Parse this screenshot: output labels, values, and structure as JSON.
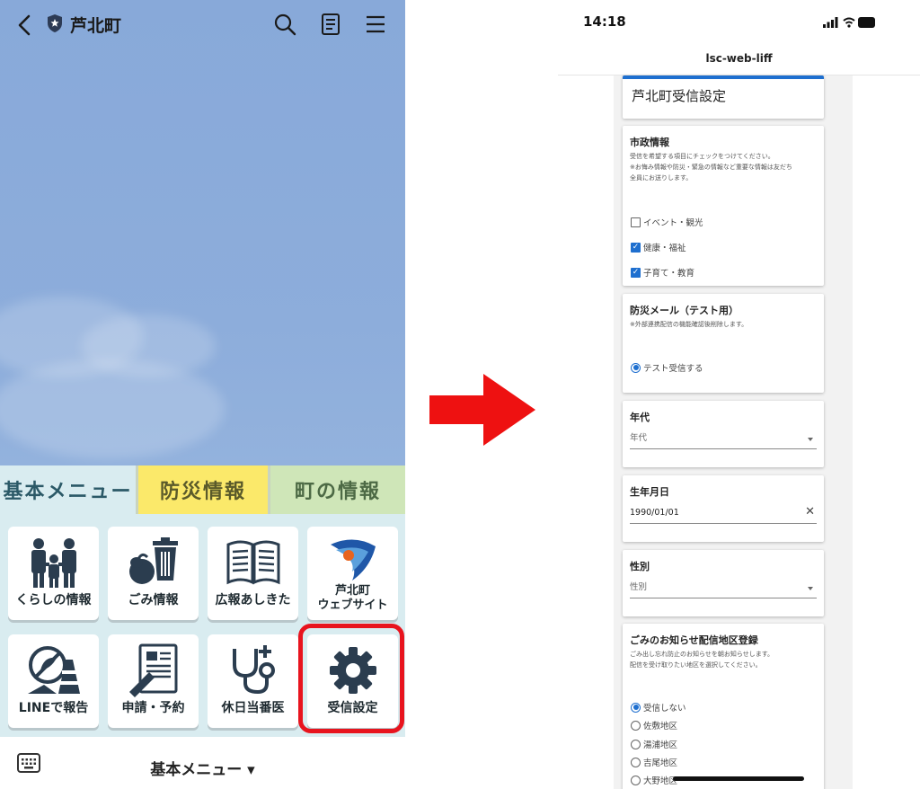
{
  "left": {
    "header": {
      "title": "芦北町"
    },
    "tabs": [
      "基本メニュー",
      "防災情報",
      "町の情報"
    ],
    "menu": [
      {
        "label": "くらしの情報",
        "icon": "family-icon"
      },
      {
        "label": "ごみ情報",
        "icon": "trash-icon"
      },
      {
        "label": "広報あしきた",
        "icon": "book-icon"
      },
      {
        "label": "芦北町\nウェブサイト",
        "icon": "town-logo-icon"
      },
      {
        "label": "LINEで報告",
        "icon": "report-icon"
      },
      {
        "label": "申請・予約",
        "icon": "document-icon"
      },
      {
        "label": "休日当番医",
        "icon": "stethoscope-icon"
      },
      {
        "label": "受信設定",
        "icon": "gear-icon"
      }
    ],
    "bottom": {
      "label": "基本メニュー ▾"
    },
    "highlight_color": "#e8141e"
  },
  "arrow_color": "#ee1111",
  "right": {
    "status": {
      "time": "14:18",
      "battery": "58"
    },
    "url": "lsc-web-liff",
    "title": "芦北町受信設定",
    "sections": {
      "city": {
        "title": "市政情報",
        "desc1": "受信を希望する項目にチェックをつけてください。",
        "desc2": "※お悔み情報や防災・緊急の情報など重要な情報は友だち",
        "desc3": "全員にお送りします。",
        "options": [
          {
            "label": "イベント・観光",
            "checked": false
          },
          {
            "label": "健康・福祉",
            "checked": true
          },
          {
            "label": "子育て・教育",
            "checked": true
          }
        ]
      },
      "disaster": {
        "title": "防災メール（テスト用）",
        "desc": "※外部連携配信の機能確認後削除します。",
        "option": "テスト受信する"
      },
      "age": {
        "title": "年代",
        "placeholder": "年代"
      },
      "birth": {
        "title": "生年月日",
        "value": "1990/01/01"
      },
      "gender": {
        "title": "性別",
        "placeholder": "性別"
      },
      "garbage": {
        "title": "ごみのお知らせ配信地区登録",
        "desc1": "ごみ出し忘れ防止のお知らせを朝お知らせします。",
        "desc2": "配信を受け取りたい地区を選択してください。",
        "options": [
          {
            "label": "受信しない",
            "selected": true
          },
          {
            "label": "佐敷地区",
            "selected": false
          },
          {
            "label": "湯浦地区",
            "selected": false
          },
          {
            "label": "吉尾地区",
            "selected": false
          },
          {
            "label": "大野地区",
            "selected": false
          }
        ]
      }
    },
    "accent": "#1e6fcf"
  }
}
